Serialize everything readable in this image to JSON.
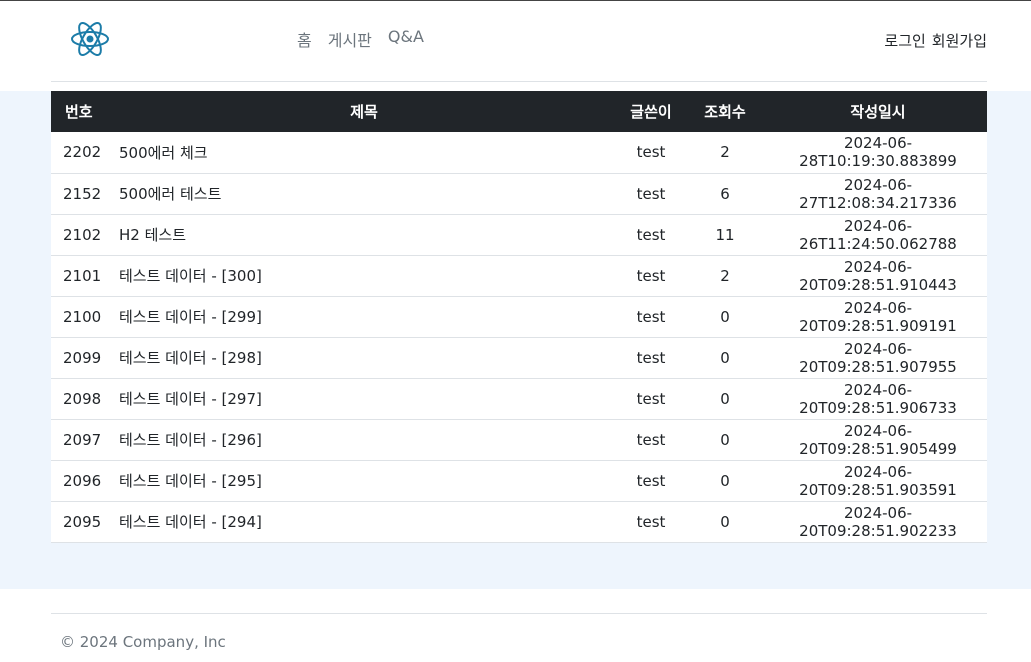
{
  "brand": {
    "logo_icon": "react-atom-icon",
    "accent": "#1c7ca8"
  },
  "nav": {
    "items": [
      "홈",
      "게시판",
      "Q&A"
    ]
  },
  "auth": {
    "login": "로그인",
    "signup": "회원가입"
  },
  "table": {
    "headers": {
      "no": "번호",
      "title": "제목",
      "writer": "글쓴이",
      "views": "조회수",
      "date": "작성일시"
    },
    "rows": [
      {
        "no": "2202",
        "title": "500에러 체크",
        "writer": "test",
        "views": "2",
        "date": "2024-06-28T10:19:30.883899"
      },
      {
        "no": "2152",
        "title": "500에러 테스트",
        "writer": "test",
        "views": "6",
        "date": "2024-06-27T12:08:34.217336"
      },
      {
        "no": "2102",
        "title": "H2 테스트",
        "writer": "test",
        "views": "11",
        "date": "2024-06-26T11:24:50.062788"
      },
      {
        "no": "2101",
        "title": "테스트 데이터 - [300]",
        "writer": "test",
        "views": "2",
        "date": "2024-06-20T09:28:51.910443"
      },
      {
        "no": "2100",
        "title": "테스트 데이터 - [299]",
        "writer": "test",
        "views": "0",
        "date": "2024-06-20T09:28:51.909191"
      },
      {
        "no": "2099",
        "title": "테스트 데이터 - [298]",
        "writer": "test",
        "views": "0",
        "date": "2024-06-20T09:28:51.907955"
      },
      {
        "no": "2098",
        "title": "테스트 데이터 - [297]",
        "writer": "test",
        "views": "0",
        "date": "2024-06-20T09:28:51.906733"
      },
      {
        "no": "2097",
        "title": "테스트 데이터 - [296]",
        "writer": "test",
        "views": "0",
        "date": "2024-06-20T09:28:51.905499"
      },
      {
        "no": "2096",
        "title": "테스트 데이터 - [295]",
        "writer": "test",
        "views": "0",
        "date": "2024-06-20T09:28:51.903591"
      },
      {
        "no": "2095",
        "title": "테스트 데이터 - [294]",
        "writer": "test",
        "views": "0",
        "date": "2024-06-20T09:28:51.902233"
      }
    ]
  },
  "footer": {
    "text": "© 2024 Company, Inc"
  }
}
